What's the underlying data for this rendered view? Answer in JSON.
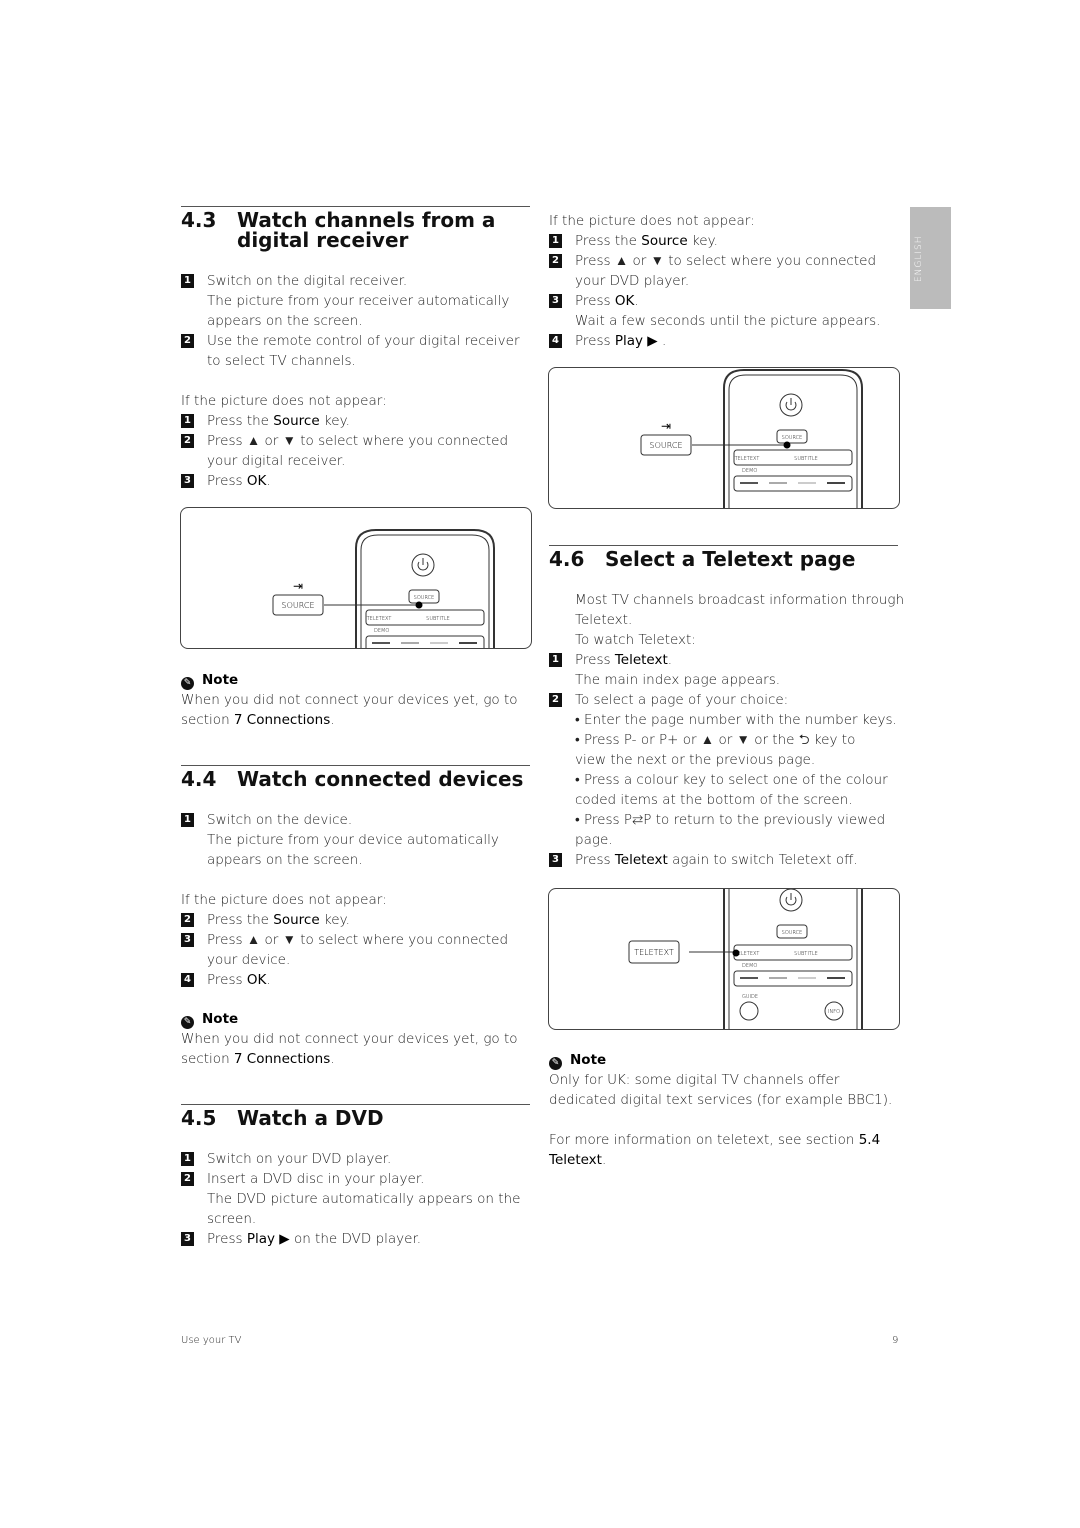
{
  "side_tab": "ENGLISH",
  "s43": {
    "num": "4.3",
    "title_1": "Watch channels from a",
    "title_2": "digital receiver",
    "steps": [
      {
        "n": "1",
        "t": "Switch on the digital receiver."
      },
      {
        "t": "The picture from your receiver automatically"
      },
      {
        "t": "appears on the screen."
      },
      {
        "n": "2",
        "t": "Use the remote control of your digital receiver"
      },
      {
        "t": "to select TV channels."
      }
    ],
    "if_not": "If the picture does not appear:",
    "steps2": [
      {
        "n": "1",
        "pre": "Press the ",
        "k": "Source",
        "post": " key."
      },
      {
        "n": "2",
        "t": "Press ▲ or ▼ to select where you connected"
      },
      {
        "t": "your digital receiver."
      },
      {
        "n": "3",
        "pre": "Press ",
        "k": "OK",
        "post": "."
      }
    ],
    "note_title": "Note",
    "note_1": "When you did not connect your devices yet, go to",
    "note_2_pre": "section ",
    "note_2_k": "7 Connections",
    "note_2_post": "."
  },
  "s44": {
    "num": "4.4",
    "title": "Watch connected devices",
    "steps": [
      {
        "n": "1",
        "t": "Switch on the device."
      },
      {
        "t": "The picture from your device automatically"
      },
      {
        "t": "appears on the screen."
      }
    ],
    "if_not": "If the picture does not appear:",
    "steps2": [
      {
        "n": "2",
        "pre": "Press the ",
        "k": "Source",
        "post": " key."
      },
      {
        "n": "3",
        "t": "Press ▲ or ▼ to select where you connected"
      },
      {
        "t": "your device."
      },
      {
        "n": "4",
        "pre": "Press ",
        "k": "OK",
        "post": "."
      }
    ],
    "note_title": "Note",
    "note_1": "When you did not connect your devices yet, go to",
    "note_2_pre": "section ",
    "note_2_k": "7 Connections",
    "note_2_post": "."
  },
  "s45": {
    "num": "4.5",
    "title": "Watch a DVD",
    "steps": [
      {
        "n": "1",
        "t": "Switch on your DVD player."
      },
      {
        "n": "2",
        "t": "Insert a DVD disc in your player."
      },
      {
        "t": "The DVD picture automatically appears on the"
      },
      {
        "t": "screen."
      },
      {
        "n": "3",
        "pre": "Press ",
        "k": "Play ▶",
        "post": " on the DVD player."
      }
    ]
  },
  "dvd_cont": {
    "if_not": "If the picture does not appear:",
    "steps": [
      {
        "n": "1",
        "pre": "Press the ",
        "k": "Source",
        "post": " key."
      },
      {
        "n": "2",
        "t": "Press ▲ or ▼ to select where you connected"
      },
      {
        "t": "your DVD player."
      },
      {
        "n": "3",
        "pre": "Press ",
        "k": "OK",
        "post": "."
      },
      {
        "t": "Wait a few seconds until the picture appears."
      },
      {
        "n": "4",
        "pre": "Press ",
        "k": "Play ▶",
        "post": " ."
      }
    ]
  },
  "s46": {
    "num": "4.6",
    "title": "Select a Teletext page",
    "lines": [
      {
        "t": "Most TV channels broadcast information through"
      },
      {
        "t": "Teletext."
      },
      {
        "t": "To watch Teletext:"
      },
      {
        "n": "1",
        "pre": "Press ",
        "k": "Teletext",
        "post": "."
      },
      {
        "t": "The main index page appears."
      },
      {
        "n": "2",
        "t": "To select a page of your choice:"
      },
      {
        "t": "• Enter the page number with the number keys."
      },
      {
        "t": "• Press P- or P+ or ▲ or ▼ or the ⮌ key  to"
      },
      {
        "t": "view the next or the previous page."
      },
      {
        "t": "• Press a colour key to select one of the colour"
      },
      {
        "t": "coded items at the bottom of the screen."
      },
      {
        "t": "• Press P⇆P to return to the previously viewed"
      },
      {
        "t": "page."
      },
      {
        "n": "3",
        "pre": "Press ",
        "k": "Teletext",
        "post": " again to switch Teletext off."
      }
    ],
    "note_title": "Note",
    "note_1": "Only for UK: some digital TV channels offer",
    "note_2": "dedicated digital text services (for example BBC1).",
    "more_pre": "For more information on teletext, see section ",
    "more_k1": "5.4",
    "more_k2": "Teletext",
    "more_post": "."
  },
  "remote": {
    "source": "SOURCE",
    "teletext": "TELETEXT",
    "subtitle": "SUBTITLE",
    "demo": "DEMO",
    "guide": "GUIDE",
    "info": "INFO"
  },
  "footer": {
    "left": "Use your TV",
    "page": "9"
  }
}
